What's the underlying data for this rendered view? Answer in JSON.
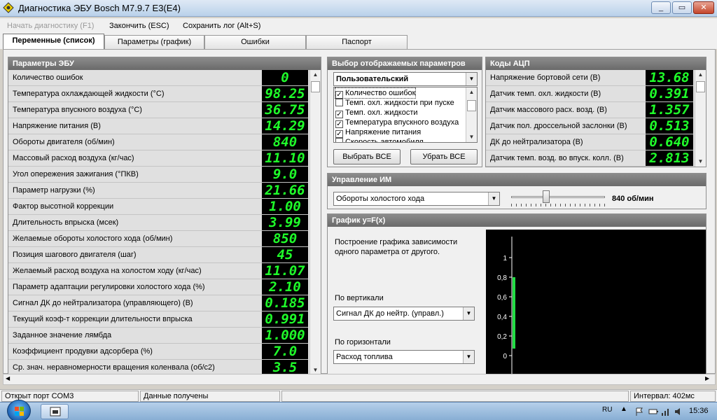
{
  "window": {
    "title": "Диагностика ЭБУ Bosch M7.9.7 E3(E4)",
    "minimize": "_",
    "maximize": "▭",
    "close": "✕"
  },
  "menu": {
    "start_diag": "Начать диагностику (F1)",
    "finish": "Закончить (ESC)",
    "save_log": "Сохранить лог (Alt+S)"
  },
  "tabs": [
    {
      "label": "Переменные (список)",
      "active": true
    },
    {
      "label": "Параметры (график)",
      "active": false
    },
    {
      "label": "Ошибки",
      "active": false
    },
    {
      "label": "Паспорт",
      "active": false
    }
  ],
  "ecu_params": {
    "title": "Параметры ЭБУ",
    "rows": [
      {
        "label": "Количество ошибок",
        "value": "0"
      },
      {
        "label": "Температура охлаждающей жидкости (°С)",
        "value": "98.25"
      },
      {
        "label": "Температура впускного воздуха (°С)",
        "value": "36.75"
      },
      {
        "label": "Напряжение питания (В)",
        "value": "14.29"
      },
      {
        "label": "Обороты двигателя (об/мин)",
        "value": "840"
      },
      {
        "label": "Массовый расход воздуха (кг/час)",
        "value": "11.10"
      },
      {
        "label": "Угол опережения зажигания (°ПКВ)",
        "value": "9.0"
      },
      {
        "label": "Параметр нагрузки (%)",
        "value": "21.66"
      },
      {
        "label": "Фактор высотной коррекции",
        "value": "1.00"
      },
      {
        "label": "Длительность впрыска (мсек)",
        "value": "3.99"
      },
      {
        "label": "Желаемые обороты холостого хода (об/мин)",
        "value": "850"
      },
      {
        "label": "Позиция шагового двигателя (шаг)",
        "value": "45"
      },
      {
        "label": "Желаемый расход воздуха на холостом ходу (кг/час)",
        "value": "11.07"
      },
      {
        "label": "Параметр адаптации регулировки холостого хода (%)",
        "value": "2.10"
      },
      {
        "label": "Сигнал ДК до нейтрализатора (управляющего) (В)",
        "value": "0.185"
      },
      {
        "label": "Текущий коэф-т коррекции длительности впрыска",
        "value": "0.991"
      },
      {
        "label": "Заданное значение лямбда",
        "value": "1.000"
      },
      {
        "label": "Коэффициент продувки адсорбера (%)",
        "value": "7.0"
      },
      {
        "label": "Ср. знач. неравномерности вращения коленвала (об/с2)",
        "value": "3.5"
      }
    ]
  },
  "select_params": {
    "title": "Выбор отображаемых параметров",
    "preset": "Пользовательский",
    "items": [
      {
        "label": "Количество ошибок",
        "checked": true
      },
      {
        "label": "Темп. охл. жидкости при пуске",
        "checked": false
      },
      {
        "label": "Темп. охл. жидкости",
        "checked": true
      },
      {
        "label": "Температура впускного воздуха",
        "checked": true
      },
      {
        "label": "Напряжение питания",
        "checked": true
      },
      {
        "label": "Скорость автомобиля",
        "checked": false
      }
    ],
    "select_all": "Выбрать ВСЕ",
    "clear_all": "Убрать ВСЕ"
  },
  "adc": {
    "title": "Коды АЦП",
    "rows": [
      {
        "label": "Напряжение бортовой сети (В)",
        "value": "13.68"
      },
      {
        "label": "Датчик темп. охл. жидкости (В)",
        "value": "0.391"
      },
      {
        "label": "Датчик массового расх. возд. (В)",
        "value": "1.357"
      },
      {
        "label": "Датчик пол. дроссельной заслонки (В)",
        "value": "0.513"
      },
      {
        "label": "ДК до нейтрализатора (В)",
        "value": "0.640"
      },
      {
        "label": "Датчик темп. возд. во впуск. колл. (В)",
        "value": "2.813"
      }
    ]
  },
  "im_control": {
    "title": "Управление ИМ",
    "actuator": "Обороты холостого хода",
    "value_label": "840 об/мин",
    "slider_fraction": 0.36
  },
  "graph": {
    "title": "График y=F(x)",
    "description_line1": "Построение графика зависимости",
    "description_line2": "одного параметра от другого.",
    "vertical_label": "По вертикали",
    "vertical_value": "Сигнал ДК до нейтр. (управл.)",
    "horizontal_label": "По горизонтали",
    "horizontal_value": "Расход топлива",
    "y_ticks": [
      "1",
      "0,8",
      "0,6",
      "0,4",
      "0,2",
      "0"
    ],
    "bar_from": 0.0,
    "bar_to": 0.8
  },
  "status": {
    "port": "Открыт порт COM3",
    "data": "Данные получены",
    "interval": "Интервал: 402мс"
  },
  "taskbar": {
    "lang": "RU",
    "time": "15:36"
  },
  "colors": {
    "lcd_text": "#1fff2a",
    "lcd_bg": "#000000",
    "plot_bar": "#22dd44"
  }
}
